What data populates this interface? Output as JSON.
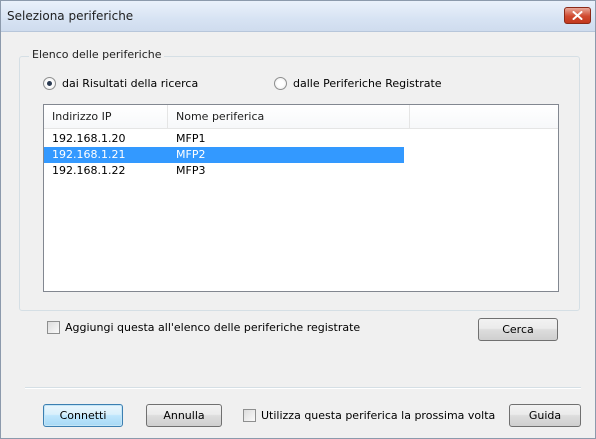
{
  "window": {
    "title": "Seleziona periferiche"
  },
  "device_list": {
    "legend": "Elenco delle periferiche",
    "radio_search": {
      "label": "dai Risultati della ricerca",
      "checked": true
    },
    "radio_registered": {
      "label": "dalle Periferiche Registrate",
      "checked": false
    },
    "columns": [
      "Indirizzo IP",
      "Nome periferica"
    ],
    "rows": [
      {
        "ip": "192.168.1.20",
        "name": "MFP1",
        "selected": false
      },
      {
        "ip": "192.168.1.21",
        "name": "MFP2",
        "selected": true
      },
      {
        "ip": "192.168.1.22",
        "name": "MFP3",
        "selected": false
      }
    ]
  },
  "add_checkbox": {
    "label": "Aggiungi questa all'elenco delle periferiche registrate",
    "checked": false
  },
  "search_button": {
    "label": "Cerca"
  },
  "footer": {
    "connect_label": "Connetti",
    "cancel_label": "Annulla",
    "next_time_checkbox": {
      "label": "Utilizza questa periferica la prossima volta",
      "checked": false
    },
    "help_label": "Guida"
  },
  "colors": {
    "selection": "#3399ff",
    "close_button": "#c2381d"
  }
}
